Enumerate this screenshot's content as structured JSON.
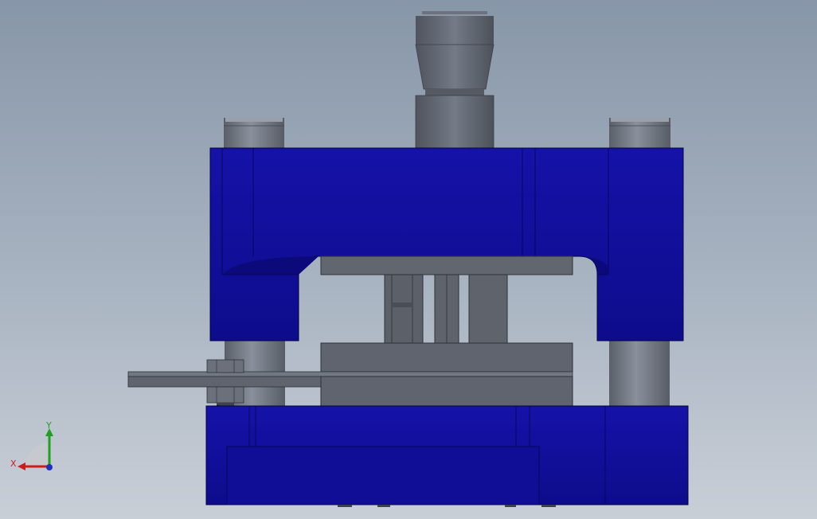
{
  "viewport": {
    "background_top": "#8796a8",
    "background_bottom": "#c9cfd7"
  },
  "model": {
    "part_colors": {
      "die_set_plates": "#12109f",
      "die_set_shadow": "#0c0a7a",
      "steel_components": "#5f646e",
      "guide_posts": "#727884"
    }
  },
  "triad": {
    "x_label": "X",
    "y_label": "Y",
    "x_color": "#c81e1e",
    "y_color": "#1fa01f",
    "z_color": "#2030c0"
  }
}
